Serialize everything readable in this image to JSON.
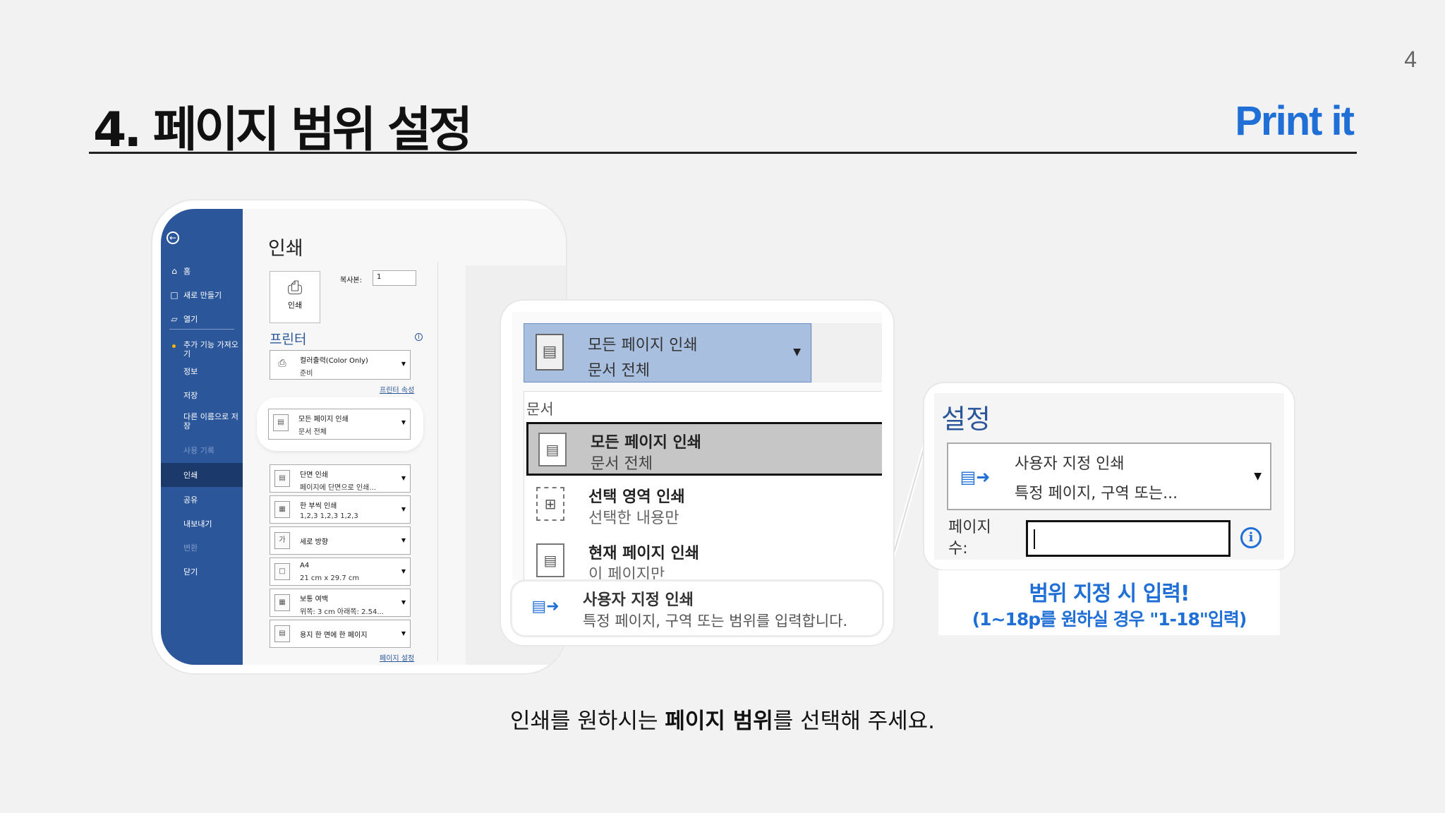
{
  "page_number": "4",
  "title": "4. 페이지 범위 설정",
  "brand": "Print it",
  "backstage": {
    "sidebar": {
      "back_icon": "back-arrow-icon",
      "items": [
        {
          "label": "홈",
          "icon": "home-icon"
        },
        {
          "label": "새로 만들기",
          "icon": "new-file-icon"
        },
        {
          "label": "열기",
          "icon": "folder-open-icon"
        },
        {
          "label": "추가 기능 가져오기"
        },
        {
          "label": "정보"
        },
        {
          "label": "저장"
        },
        {
          "label": "다른 이름으로 저장"
        },
        {
          "label": "사용 기록"
        },
        {
          "label": "인쇄"
        },
        {
          "label": "공유"
        },
        {
          "label": "내보내기"
        },
        {
          "label": "변환"
        },
        {
          "label": "닫기"
        }
      ],
      "active": "인쇄"
    },
    "heading": "인쇄",
    "print_button_label": "인쇄",
    "copies_label": "복사본:",
    "copies_value": "1",
    "printer_section": "프린터",
    "printer": {
      "name": "컬러출력(Color Only)",
      "status": "준비"
    },
    "printer_props_link": "프린터 속성",
    "settings_section": "설정",
    "settings": [
      {
        "line1": "모든 페이지 인쇄",
        "line2": "문서 전체"
      },
      {
        "line1": "단면 인쇄",
        "line2": "페이지에 단면으로 인쇄..."
      },
      {
        "line1": "한 부씩 인쇄",
        "line2": "1,2,3    1,2,3    1,2,3"
      },
      {
        "line1": "세로 방향",
        "line2": ""
      },
      {
        "line1": "A4",
        "line2": "21 cm x 29.7 cm"
      },
      {
        "line1": "보통 여백",
        "line2": "위쪽: 3 cm 아래쪽: 2.54..."
      },
      {
        "line1": "용지 한 면에 한 페이지",
        "line2": ""
      }
    ],
    "page_setup_link": "페이지 설정"
  },
  "dropdown_zoom": {
    "selected": {
      "line1": "모든 페이지 인쇄",
      "line2": "문서 전체"
    },
    "category": "문서",
    "options": [
      {
        "line1": "모든 페이지 인쇄",
        "line2": "문서 전체"
      },
      {
        "line1": "선택 영역 인쇄",
        "line2": "선택한 내용만"
      },
      {
        "line1": "현재 페이지 인쇄",
        "line2": "이 페이지만"
      }
    ],
    "custom": {
      "line1": "사용자 지정 인쇄",
      "line2": "특정 페이지, 구역 또는 범위를 입력합니다."
    }
  },
  "range_zoom": {
    "title": "설정",
    "dropdown": {
      "line1": "사용자 지정 인쇄",
      "line2": "특정 페이지, 구역 또는..."
    },
    "pages_label": "페이지 수:",
    "pages_value": ""
  },
  "note": {
    "line1": "범위 지정 시 입력!",
    "line2": "(1~18p를 원하실 경우 \"1-18\"입력)"
  },
  "caption": {
    "before": "인쇄를 원하시는 ",
    "bold": "페이지 범위",
    "after": "를 선택해 주세요."
  },
  "colors": {
    "accent": "#1f6fd6",
    "word_blue": "#2b579a"
  }
}
